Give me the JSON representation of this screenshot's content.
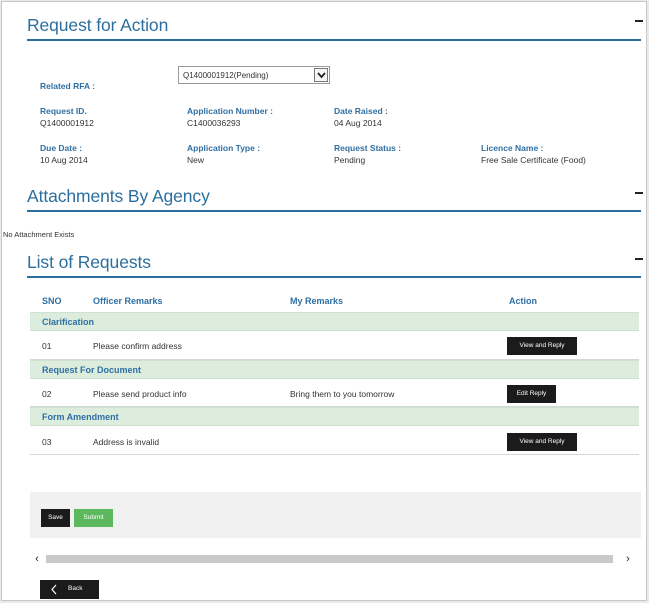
{
  "request_for_action": {
    "title": "Request for Action",
    "related_rfa_label": "Related RFA :",
    "related_rfa_value": "Q1400001912(Pending)",
    "fields": {
      "request_id_label": "Request ID.",
      "request_id_value": "Q1400001912",
      "application_number_label": "Application Number :",
      "application_number_value": "C1400036293",
      "date_raised_label": "Date Raised :",
      "date_raised_value": "04 Aug 2014",
      "due_date_label": "Due Date :",
      "due_date_value": "10 Aug 2014",
      "application_type_label": "Application Type :",
      "application_type_value": "New",
      "request_status_label": "Request Status :",
      "request_status_value": "Pending",
      "licence_name_label": "Licence Name :",
      "licence_name_value": "Free Sale Certificate (Food)"
    }
  },
  "attachments": {
    "title": "Attachments By Agency",
    "empty_text": "No Attachment Exists"
  },
  "requests": {
    "title": "List of Requests",
    "columns": {
      "sno": "SNO",
      "officer_remarks": "Officer Remarks",
      "my_remarks": "My Remarks",
      "action": "Action"
    },
    "groups": [
      {
        "name": "Clarification",
        "sno": "01",
        "officer_remarks": "Please confirm address",
        "my_remarks": "",
        "action": "View and Reply"
      },
      {
        "name": "Request For Document",
        "sno": "02",
        "officer_remarks": "Please send product info",
        "my_remarks": "Bring them to you tomorrow",
        "action": "Edit Reply"
      },
      {
        "name": "Form Amendment",
        "sno": "03",
        "officer_remarks": "Address is invalid",
        "my_remarks": "",
        "action": "View and Reply"
      }
    ]
  },
  "footer": {
    "save_label": "Save",
    "submit_label": "Submit",
    "back_label": "Back"
  },
  "colors": {
    "accent": "#2e6e9c",
    "group_bg": "#dcecdd",
    "submit": "#5cb85c",
    "dark_button": "#1b1b1b"
  }
}
